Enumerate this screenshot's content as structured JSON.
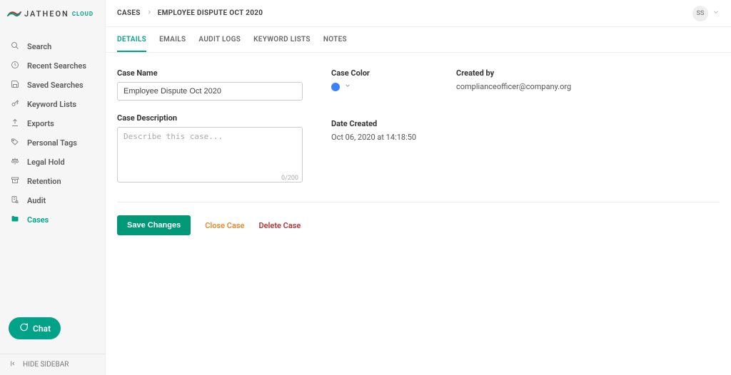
{
  "brand": {
    "word": "JATHEON",
    "suffix": "CLOUD"
  },
  "sidebar": {
    "items": [
      {
        "label": "Search"
      },
      {
        "label": "Recent Searches"
      },
      {
        "label": "Saved Searches"
      },
      {
        "label": "Keyword Lists"
      },
      {
        "label": "Exports"
      },
      {
        "label": "Personal Tags"
      },
      {
        "label": "Legal Hold"
      },
      {
        "label": "Retention"
      },
      {
        "label": "Audit"
      },
      {
        "label": "Cases"
      }
    ],
    "chat": "Chat",
    "hide": "HIDE SIDEBAR"
  },
  "breadcrumb": {
    "root": "CASES",
    "current": "EMPLOYEE DISPUTE OCT 2020"
  },
  "user": {
    "initials": "SS"
  },
  "tabs": [
    "DETAILS",
    "EMAILS",
    "AUDIT LOGS",
    "KEYWORD LISTS",
    "NOTES"
  ],
  "form": {
    "caseNameLabel": "Case Name",
    "caseNameValue": "Employee Dispute Oct 2020",
    "caseDescLabel": "Case Description",
    "caseDescPlaceholder": "Describe this case...",
    "charCount": "0/200",
    "caseColorLabel": "Case Color",
    "dateCreatedLabel": "Date Created",
    "dateCreatedValue": "Oct 06, 2020 at 14:18:50",
    "createdByLabel": "Created by",
    "createdByValue": "complianceofficer@company.org"
  },
  "actions": {
    "save": "Save Changes",
    "close": "Close Case",
    "delete": "Delete Case"
  }
}
